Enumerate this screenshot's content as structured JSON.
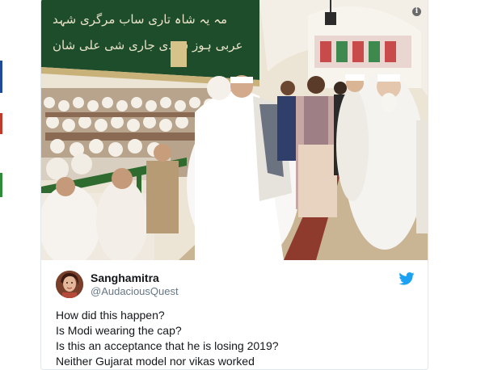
{
  "tweet": {
    "author_name": "Sanghamitra",
    "author_handle": "@AudaciousQuest",
    "lines": [
      "How did this happen?",
      "Is Modi wearing the cap?",
      "Is this an acceptance that he is losing 2019?",
      "Neither Gujarat model nor vikas worked"
    ]
  },
  "media": {
    "info_icon": "i",
    "banner_text_line1": "مہ یہ شاہ تاری ساب مرگری شہد",
    "banner_text_line2": "عربی ہوز سیدی جاری شی علی شان"
  },
  "icons": {
    "info": "info-icon",
    "bird": "twitter-bird-icon",
    "avatar": "avatar-photo"
  },
  "colors": {
    "twitter_blue": "#1da1f2",
    "banner_green": "#1e4d2b",
    "text": "#14171a",
    "handle": "#657786"
  }
}
